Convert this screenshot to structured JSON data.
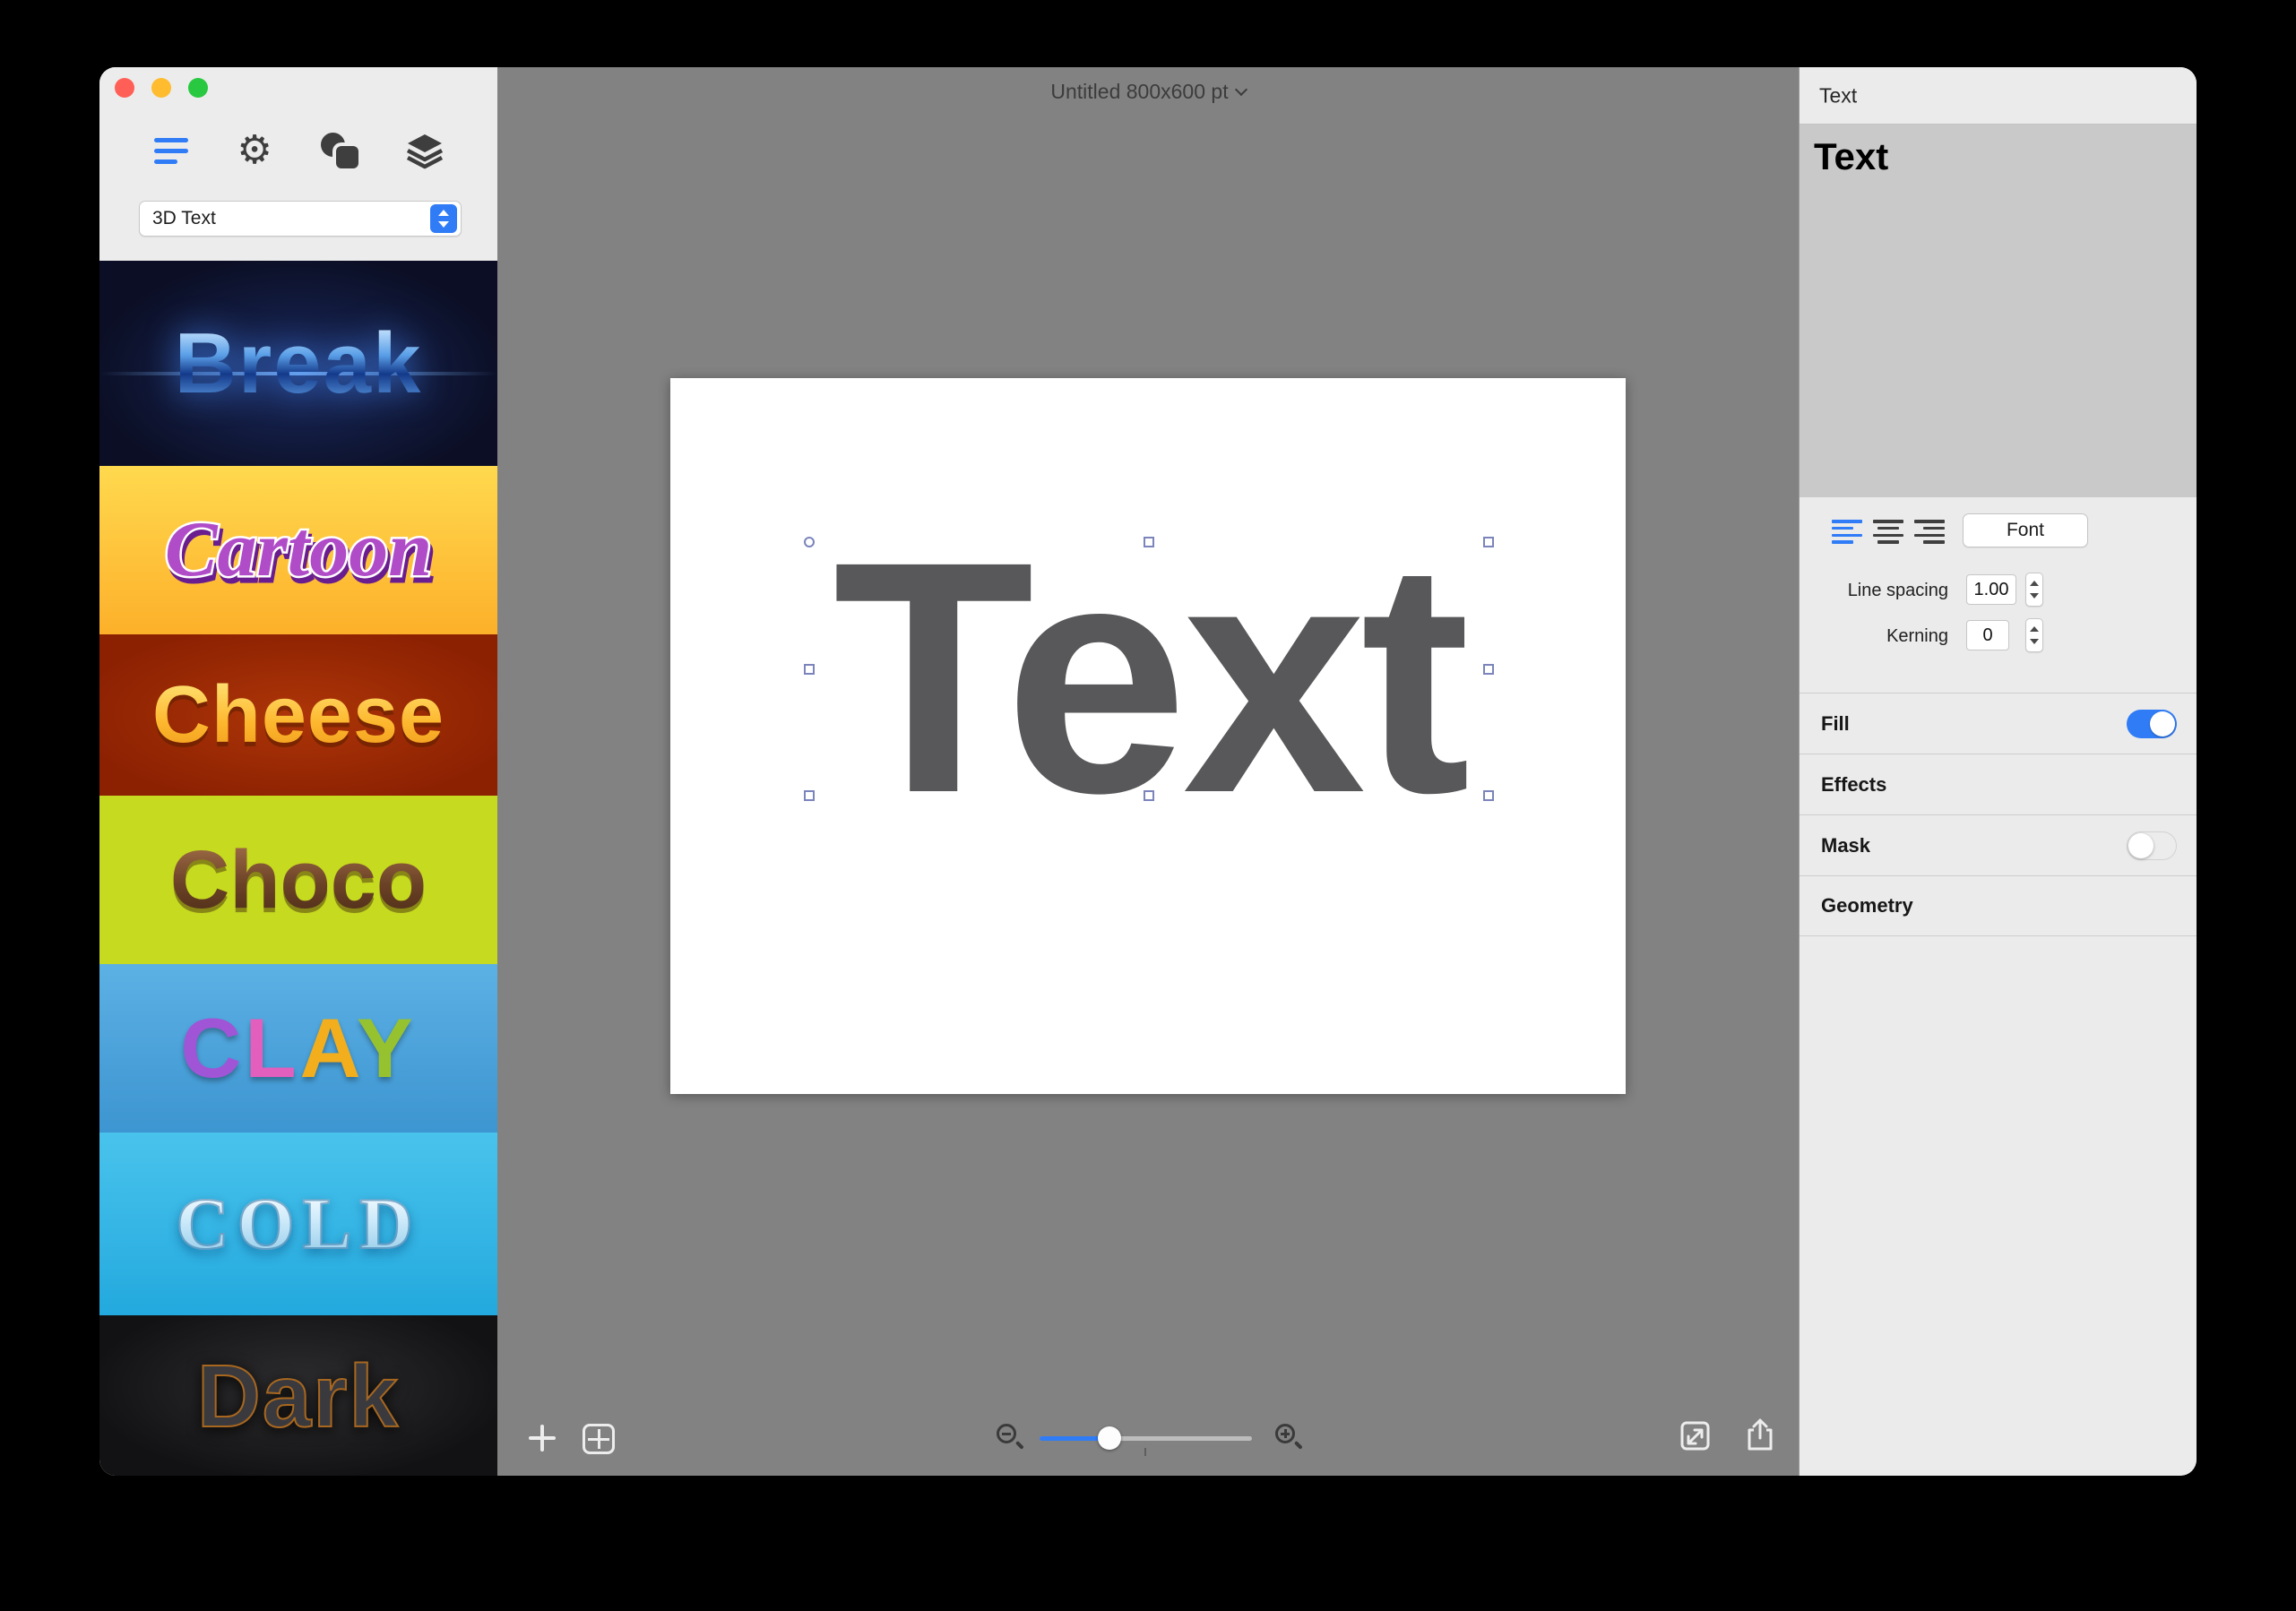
{
  "titlebar": {
    "title": "Untitled 800x600 pt"
  },
  "sidebar": {
    "style_dropdown_value": "3D Text",
    "templates": [
      {
        "label": "Break"
      },
      {
        "label": "Cartoon"
      },
      {
        "label": "Cheese"
      },
      {
        "label": "Choco"
      },
      {
        "label": "CLAY",
        "letters": [
          "C",
          "L",
          "A",
          "Y"
        ]
      },
      {
        "label": "COLD"
      },
      {
        "label": "Dark"
      }
    ]
  },
  "canvas": {
    "artboard_text": "Text"
  },
  "inspector": {
    "panel_header": "Text",
    "text_content": "Text",
    "font_button_label": "Font",
    "line_spacing_label": "Line spacing",
    "line_spacing_value": "1.00",
    "kerning_label": "Kerning",
    "kerning_value": "0",
    "fill_label": "Fill",
    "fill_enabled": true,
    "effects_label": "Effects",
    "mask_label": "Mask",
    "mask_enabled": false,
    "geometry_label": "Geometry"
  },
  "colors": {
    "accent_blue": "#2f7cf6",
    "toggle_on": "#2f7cf6",
    "traffic_red": "#ff5f57",
    "traffic_yellow": "#febc2e",
    "traffic_green": "#28c840"
  },
  "icons": {
    "sidebar_toolbar": [
      "templates-icon",
      "gear-icon",
      "shapes-icon",
      "layers-icon"
    ],
    "canvas_toolbar": [
      "add-icon",
      "pages-icon",
      "zoom-out-icon",
      "zoom-slider",
      "zoom-in-icon",
      "expand-icon",
      "share-icon"
    ],
    "inspector": [
      "align-left-icon",
      "align-center-icon",
      "align-right-icon"
    ]
  }
}
